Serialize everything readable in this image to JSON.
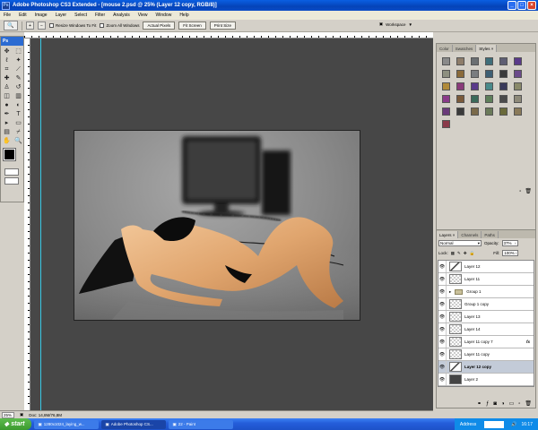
{
  "window": {
    "title": "Adobe Photoshop CS3 Extended - [mouse 2.psd @ 25% (Layer 12 copy, RGB/8)]",
    "app_badge": "Ps"
  },
  "menu": [
    "File",
    "Edit",
    "Image",
    "Layer",
    "Select",
    "Filter",
    "Analysis",
    "View",
    "Window",
    "Help"
  ],
  "options_bar": {
    "resize_windows": "Resize Windows To Fit",
    "zoom_all_windows": "Zoom All Windows",
    "actual_pixels": "Actual Pixels",
    "fit_screen": "Fit Screen",
    "print_size": "Print Size",
    "workspace": "Workspace"
  },
  "toolbox": {
    "badge": "Ps"
  },
  "status": {
    "zoom": "25%",
    "doc": "Doc: 14,8M/76,8M"
  },
  "swatch_panel": {
    "tabs": [
      "Color",
      "Swatches",
      "Styles"
    ],
    "active_tab": "Styles",
    "swatch_colors": [
      "#8a8a8a",
      "#8e7d6a",
      "#6b6f72",
      "#3f6e7a",
      "#5e5e73",
      "#5a3a8a",
      "#8d8f80",
      "#8a6a3a",
      "#7a7d80",
      "#3e5f74",
      "#3a3a3a",
      "#6b4a8a",
      "#b08a3a",
      "#8a3a7a",
      "#5a3a8a",
      "#4a8a8a",
      "#3a3a5a",
      "#8a8a6a",
      "#8a3a8a",
      "#7a5a3a",
      "#3a6a5a",
      "#5e7f5a",
      "#4a4a4a",
      "#8e8a7a",
      "#6a3a7a",
      "#3a3a3a",
      "#7a6a4a",
      "#6a7a5a",
      "#6a6a3a",
      "#8a7a5a",
      "#8a3a4a"
    ]
  },
  "layers_panel": {
    "tabs": [
      "Layers",
      "Channels",
      "Paths"
    ],
    "active_tab": "Layers",
    "blend_mode": "Normal",
    "opacity_label": "Opacity:",
    "opacity": "37%",
    "lock_label": "Lock:",
    "fill_label": "Fill:",
    "fill": "100%",
    "layers": [
      {
        "name": "Layer 12",
        "type": "layer",
        "thumb": "art",
        "selected": false,
        "fx": ""
      },
      {
        "name": "Layer 11",
        "type": "layer",
        "thumb": "empty",
        "selected": false,
        "fx": ""
      },
      {
        "name": "Group 1",
        "type": "group",
        "thumb": "",
        "selected": false,
        "fx": ""
      },
      {
        "name": "Group 1 copy",
        "type": "layer",
        "thumb": "empty",
        "selected": false,
        "fx": ""
      },
      {
        "name": "Layer 13",
        "type": "layer",
        "thumb": "empty",
        "selected": false,
        "fx": ""
      },
      {
        "name": "Layer 14",
        "type": "layer",
        "thumb": "empty",
        "selected": false,
        "fx": ""
      },
      {
        "name": "Layer 11 copy 7",
        "type": "layer",
        "thumb": "empty",
        "selected": false,
        "fx": "fx"
      },
      {
        "name": "Layer 11 copy",
        "type": "layer",
        "thumb": "empty",
        "selected": false,
        "fx": ""
      },
      {
        "name": "Layer 12 copy",
        "type": "layer",
        "thumb": "art",
        "selected": true,
        "fx": ""
      },
      {
        "name": "Layer 2",
        "type": "layer",
        "thumb": "dark",
        "selected": false,
        "fx": ""
      }
    ]
  },
  "taskbar": {
    "start": "start",
    "tasks": [
      "1280x1024_laying_w...",
      "Adobe Photoshop CS...",
      "22 - Paint"
    ],
    "active_task": 1,
    "address": "Address",
    "time": "16:17"
  }
}
